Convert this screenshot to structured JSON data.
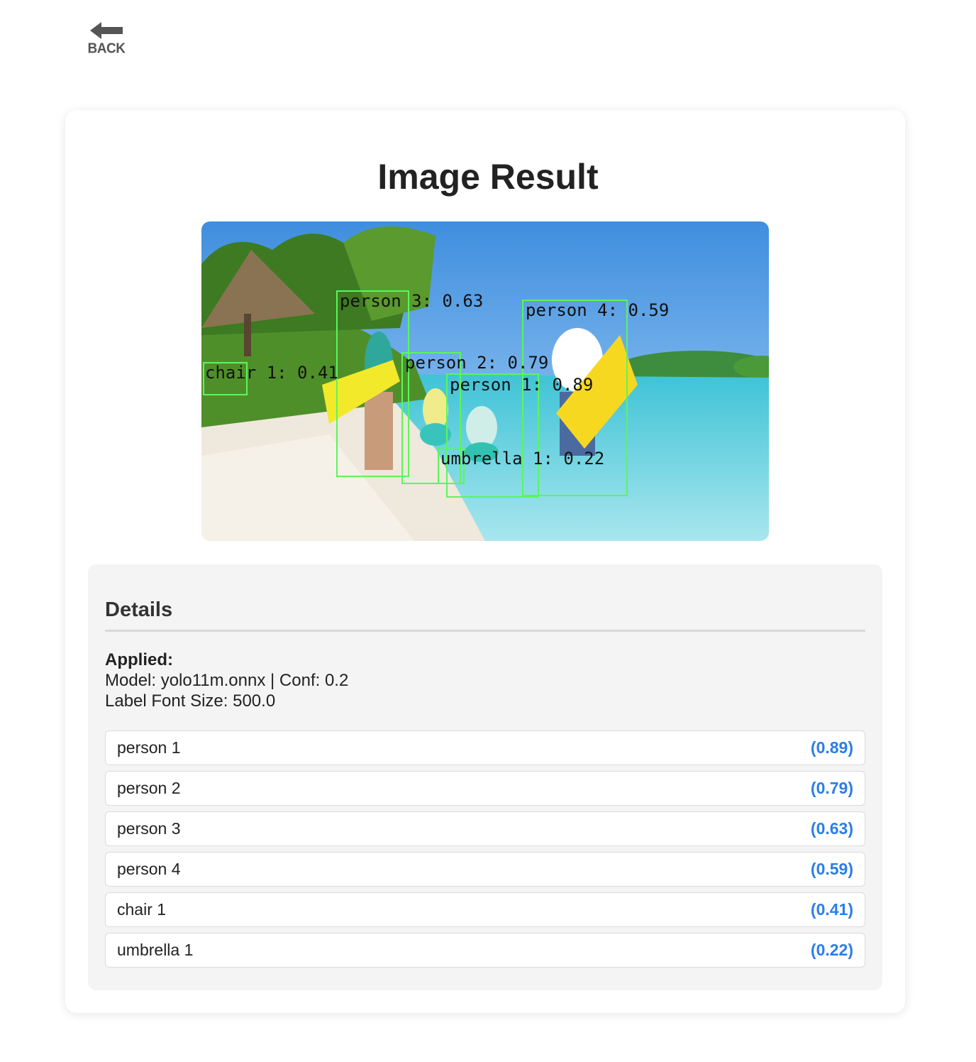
{
  "nav": {
    "back_label": "BACK"
  },
  "header": {
    "title": "Image Result"
  },
  "image": {
    "annotations": [
      {
        "label": "person 3: 0.63"
      },
      {
        "label": "person 4: 0.59"
      },
      {
        "label": "person 2: 0.79"
      },
      {
        "label": "person 1: 0.89"
      },
      {
        "label": "chair 1: 0.41"
      },
      {
        "label": "umbrella 1: 0.22"
      }
    ]
  },
  "details": {
    "title": "Details",
    "applied_label": "Applied:",
    "model_line": "Model: yolo11m.onnx | Conf: 0.2",
    "font_line": "Label Font Size: 500.0",
    "detections": [
      {
        "name": "person 1",
        "confidence": "(0.89)"
      },
      {
        "name": "person 2",
        "confidence": "(0.79)"
      },
      {
        "name": "person 3",
        "confidence": "(0.63)"
      },
      {
        "name": "person 4",
        "confidence": "(0.59)"
      },
      {
        "name": "chair 1",
        "confidence": "(0.41)"
      },
      {
        "name": "umbrella 1",
        "confidence": "(0.22)"
      }
    ]
  },
  "colors": {
    "accent": "#2b7de9",
    "box": "#5cf55c",
    "sky": "#4f97e0",
    "sea": "#5dcfe0",
    "sand": "#f1ebe0"
  }
}
